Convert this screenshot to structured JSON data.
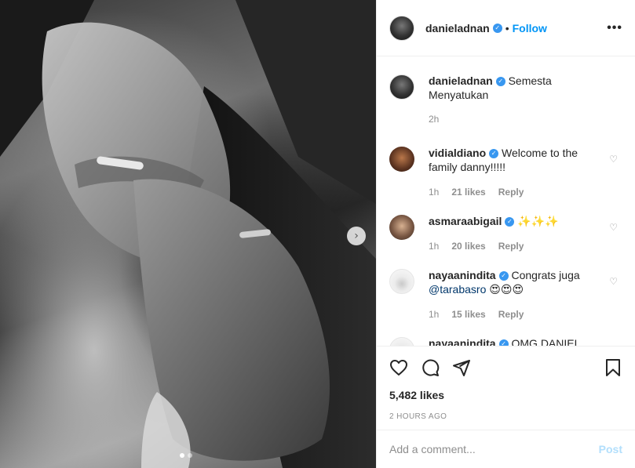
{
  "post": {
    "author": "danieladnan",
    "follow_label": "Follow",
    "separator": "•",
    "more_icon": "more-horizontal-icon",
    "next_icon": "chevron-right-icon",
    "caption": {
      "username": "danieladnan",
      "text": "Semesta Menyatukan",
      "time": "2h"
    },
    "comments": [
      {
        "username": "vidialdiano",
        "text": "Welcome to the family danny!!!!!",
        "time": "1h",
        "likes": "21 likes",
        "reply": "Reply"
      },
      {
        "username": "asmaraabigail",
        "text": "✨✨✨",
        "time": "1h",
        "likes": "20 likes",
        "reply": "Reply"
      },
      {
        "username": "nayaanindita",
        "text": "Congrats juga",
        "mention": "@tarabasro",
        "emoji": "😍😍😍",
        "time": "1h",
        "likes": "15 likes",
        "reply": "Reply"
      },
      {
        "username": "nayaanindita",
        "text": "OMG DANIEL"
      }
    ],
    "likes": "5,482 likes",
    "posted": "2 HOURS AGO",
    "add_comment_placeholder": "Add a comment...",
    "post_label": "Post"
  },
  "colors": {
    "accent": "#0095f6",
    "verified": "#3897f0",
    "post_disabled": "#b2dffc",
    "muted": "#8e8e8e"
  }
}
